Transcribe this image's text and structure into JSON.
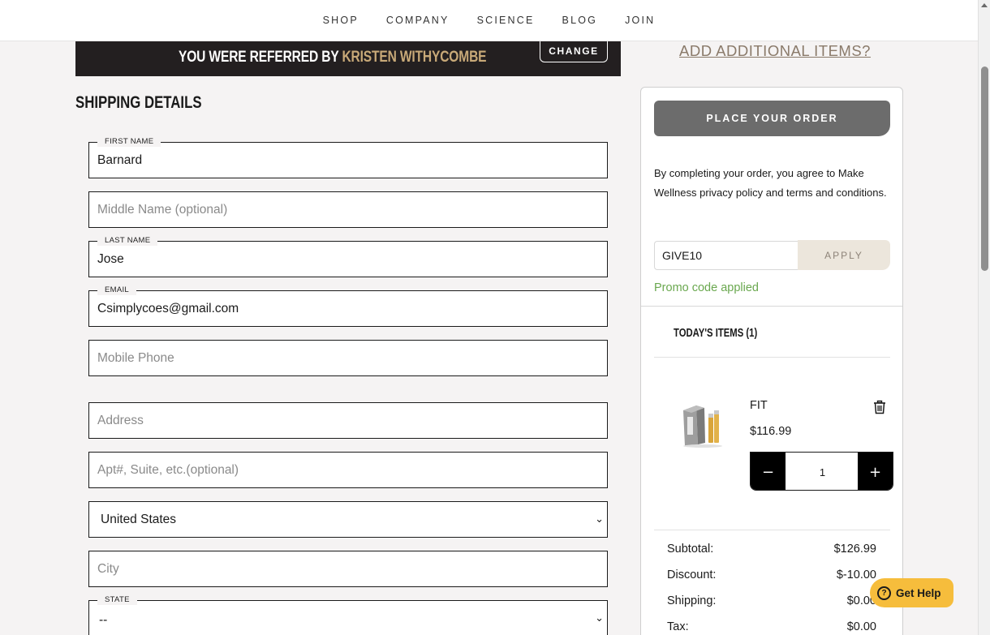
{
  "nav": {
    "items": [
      {
        "label": "SHOP"
      },
      {
        "label": "COMPANY"
      },
      {
        "label": "SCIENCE"
      },
      {
        "label": "BLOG"
      },
      {
        "label": "JOIN"
      }
    ]
  },
  "referral": {
    "prefix": "YOU WERE REFERRED BY ",
    "name": "KRISTEN WITHYCOMBE",
    "change_label": "CHANGE"
  },
  "shipping": {
    "title": "SHIPPING DETAILS",
    "first_name": {
      "label": "FIRST NAME",
      "value": "Barnard"
    },
    "middle_name": {
      "placeholder": "Middle Name (optional)"
    },
    "last_name": {
      "label": "LAST NAME",
      "value": "Jose"
    },
    "email": {
      "label": "EMAIL",
      "value": "Csimplycoes@gmail.com"
    },
    "mobile_phone": {
      "placeholder": "Mobile Phone"
    },
    "address": {
      "placeholder": "Address"
    },
    "apt": {
      "placeholder": "Apt#, Suite, etc.(optional)"
    },
    "country": {
      "value": "United States"
    },
    "city": {
      "placeholder": "City"
    },
    "state": {
      "label": "STATE",
      "value": "--"
    }
  },
  "summary": {
    "add_items_label": "ADD ADDITIONAL ITEMS?",
    "place_order_label": "PLACE YOUR ORDER",
    "agreement_text": "By completing your order, you agree to Make Wellness privacy policy and terms and conditions.",
    "promo": {
      "value": "GIVE10",
      "apply_label": "APPLY",
      "status": "Promo code applied",
      "status_color": "#6aa84f"
    },
    "items_title": "TODAY'S ITEMS (1)",
    "item": {
      "name": "FIT",
      "price": "$116.99",
      "quantity": "1",
      "image_icon": "product-box-image",
      "remove_icon": "trash-icon"
    },
    "totals": [
      {
        "label": "Subtotal:",
        "value": "$126.99"
      },
      {
        "label": "Discount:",
        "value": "$-10.00"
      },
      {
        "label": "Shipping:",
        "value": "$0.00"
      },
      {
        "label": "Tax:",
        "value": "$0.00"
      }
    ]
  },
  "help": {
    "label": "Get Help",
    "icon": "question-circle-icon",
    "color": "#f6bd3c"
  }
}
